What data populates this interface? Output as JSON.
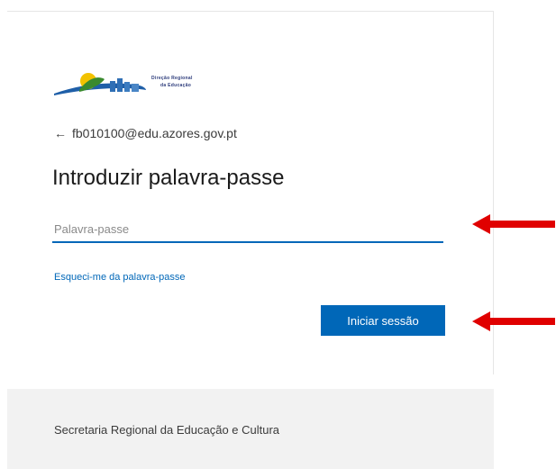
{
  "header": {
    "logo_caption_line1": "Direção Regional",
    "logo_caption_line2": "da Educação",
    "back_icon": "arrow-left-icon",
    "account_email": "fb010100@edu.azores.gov.pt"
  },
  "form": {
    "title": "Introduzir palavra-passe",
    "password_placeholder": "Palavra-passe",
    "password_value": "",
    "forgot_link": "Esqueci-me da palavra-passe",
    "signin_label": "Iniciar sessão"
  },
  "footer": {
    "text": "Secretaria Regional da Educação e Cultura"
  },
  "annotations": {
    "arrow_icon": "red-arrow-left-icon",
    "arrow_color": "#e00000"
  },
  "colors": {
    "accent": "#0067b8",
    "footer_bg": "#f2f2f2",
    "text": "#1b1b1b"
  }
}
